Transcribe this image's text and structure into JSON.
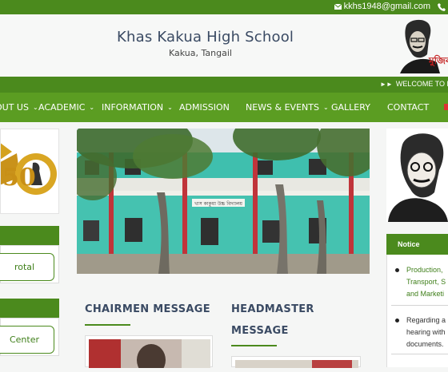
{
  "topbar": {
    "email": "kkhs1948@gmail.com",
    "mail_icon": "envelope-icon",
    "phone_icon": "phone-icon"
  },
  "header": {
    "school_name": "Khas Kakua High School",
    "location": "Kakua, Tangail",
    "portrait_caption": "মুজিব"
  },
  "ticker": {
    "text": "WELCOME TO Kh"
  },
  "nav": {
    "items": [
      {
        "label": "OUT US",
        "caret": true
      },
      {
        "label": "ACADEMIC",
        "caret": true
      },
      {
        "label": "INFORMATION",
        "caret": true
      },
      {
        "label": "ADMISSION",
        "caret": false
      },
      {
        "label": "NEWS & EVENTS",
        "caret": true
      },
      {
        "label": "GALLERY",
        "caret": false
      },
      {
        "label": "CONTACT",
        "caret": false
      }
    ]
  },
  "left_sidebar": {
    "emblem_text": "50",
    "links": [
      {
        "label": "rotal"
      },
      {
        "label": "Center"
      }
    ]
  },
  "main": {
    "building_sign": "খাস কাকুয়া উচ্চ বিদ্যালয়",
    "chairmen_title": "CHAIRMEN MESSAGE",
    "headmaster_title_1": "HEADMASTER",
    "headmaster_title_2": "MESSAGE"
  },
  "notice": {
    "title": "Notice",
    "items": [
      {
        "lines": [
          "Production,",
          "Transport, S",
          "and Marketi"
        ]
      },
      {
        "lines": [
          "Regarding a",
          "hearing with",
          "documents."
        ]
      }
    ]
  },
  "colors": {
    "brand_green": "#4b8a1d",
    "nav_green": "#5b9d22",
    "title_navy": "#3a4a63"
  }
}
